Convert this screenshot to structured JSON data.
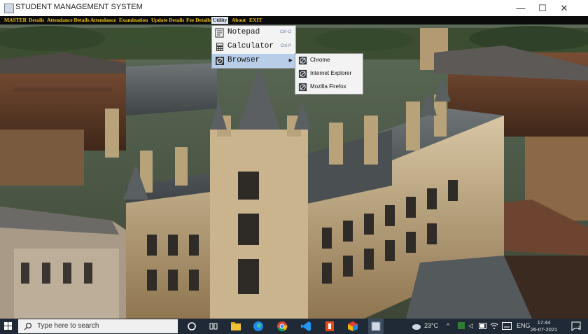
{
  "window": {
    "title": "STUDENT MANAGEMENT SYSTEM",
    "controls": {
      "minimize": "—",
      "maximize": "☐",
      "close": "✕"
    }
  },
  "menubar": {
    "items": [
      {
        "label": "MASTER"
      },
      {
        "label": "Details"
      },
      {
        "label": "Attendance Details"
      },
      {
        "label": "Attendance"
      },
      {
        "label": "Examination"
      },
      {
        "label": "Update Details"
      },
      {
        "label": "Fee Details"
      },
      {
        "label": "Utility"
      },
      {
        "label": "About"
      },
      {
        "label": "EXIT"
      }
    ],
    "active": "Utility"
  },
  "utility_menu": {
    "items": [
      {
        "label": "Notepad",
        "shortcut": "Ctrl-O",
        "icon": "notepad-icon"
      },
      {
        "label": "Calculator",
        "shortcut": "Ctrl-P",
        "icon": "calculator-icon"
      },
      {
        "label": "Browser",
        "shortcut": "",
        "icon": "browser-icon",
        "has_submenu": true
      }
    ],
    "highlighted": "Browser"
  },
  "browser_submenu": {
    "items": [
      {
        "label": "Chrome",
        "icon": "browser-icon"
      },
      {
        "label": "Internet Explorer",
        "icon": "browser-icon"
      },
      {
        "label": "Mozilla Firefox",
        "icon": "browser-icon"
      }
    ]
  },
  "taskbar": {
    "search_placeholder": "Type here to search",
    "pinned": [
      "task-view-icon",
      "file-explorer-icon",
      "edge-icon",
      "chrome-icon",
      "vscode-icon",
      "office-icon",
      "app-icon",
      "java-app-icon"
    ],
    "weather": "23°C",
    "language": "ENG",
    "time": "17:44",
    "date": "26-07-2021",
    "notifications": "3"
  },
  "colors": {
    "menu_text": "#f1c40f",
    "menubar_bg": "#0b0b0b",
    "menu_highlight": "#b8cde8",
    "taskbar_bg": "#1f2a36"
  }
}
